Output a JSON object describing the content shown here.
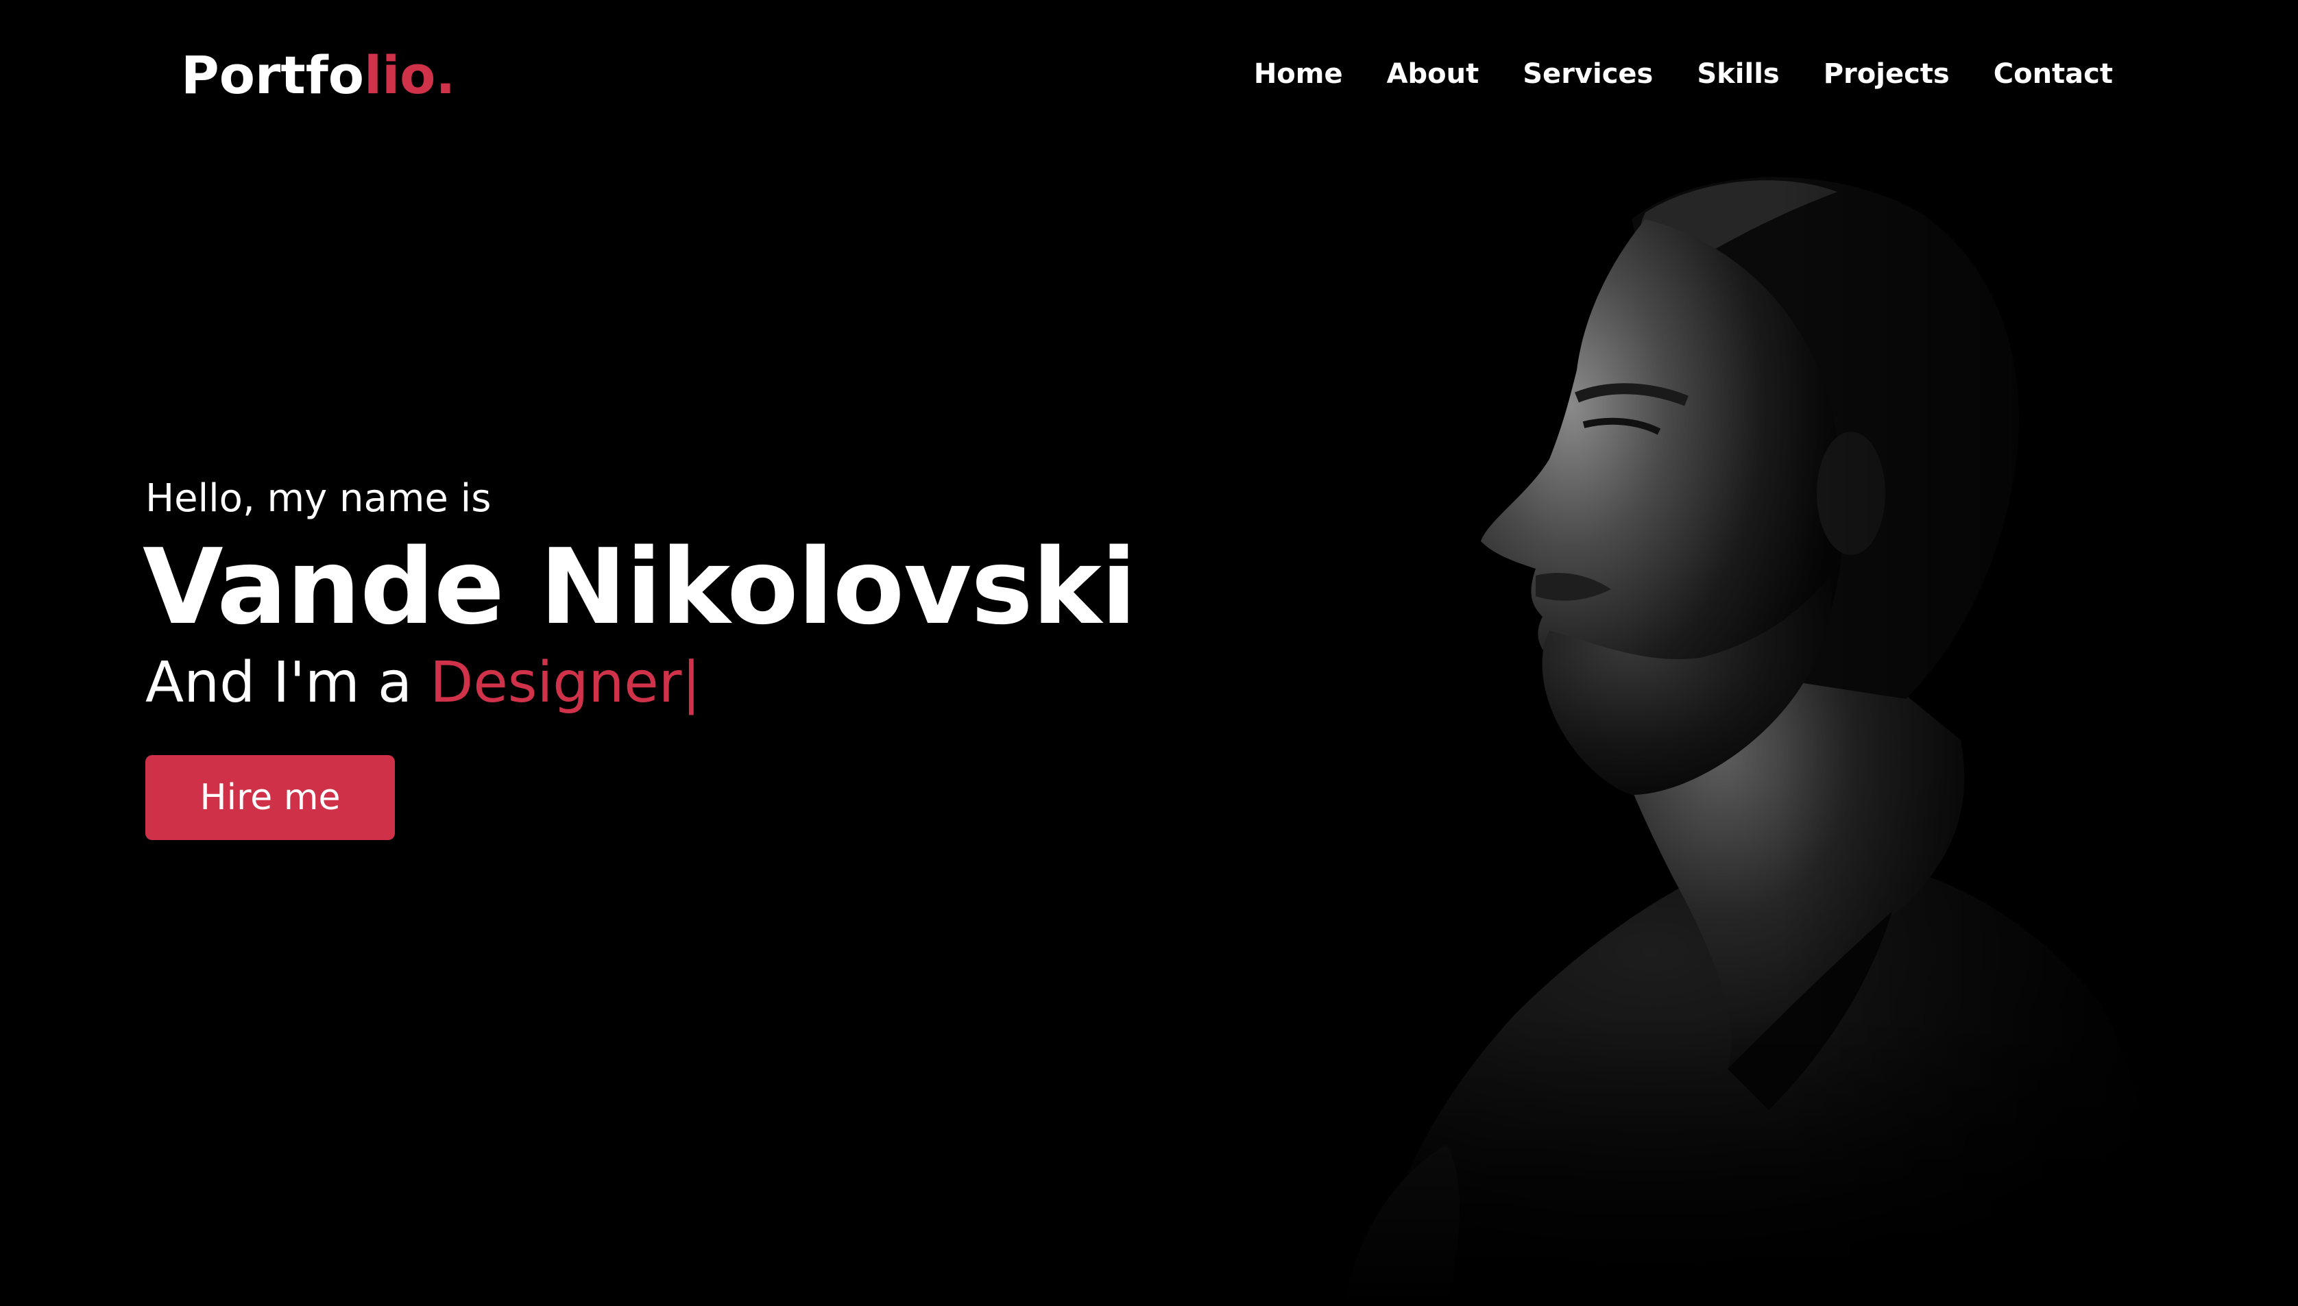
{
  "brand": {
    "logo_main": "Portfo",
    "logo_accent": "lio.",
    "accent_color": "#d0324a"
  },
  "nav": {
    "items": [
      {
        "label": "Home"
      },
      {
        "label": "About"
      },
      {
        "label": "Services"
      },
      {
        "label": "Skills"
      },
      {
        "label": "Projects"
      },
      {
        "label": "Contact"
      }
    ]
  },
  "hero": {
    "greeting": "Hello, my name is",
    "name": "Vande Nikolovski",
    "role_prefix": "And I'm a ",
    "role_word": "Designer",
    "caret": "|",
    "cta_label": "Hire me",
    "image_icon": "portrait-photo"
  },
  "colors": {
    "background": "#000000",
    "text": "#ffffff",
    "button": "#cf3148"
  }
}
